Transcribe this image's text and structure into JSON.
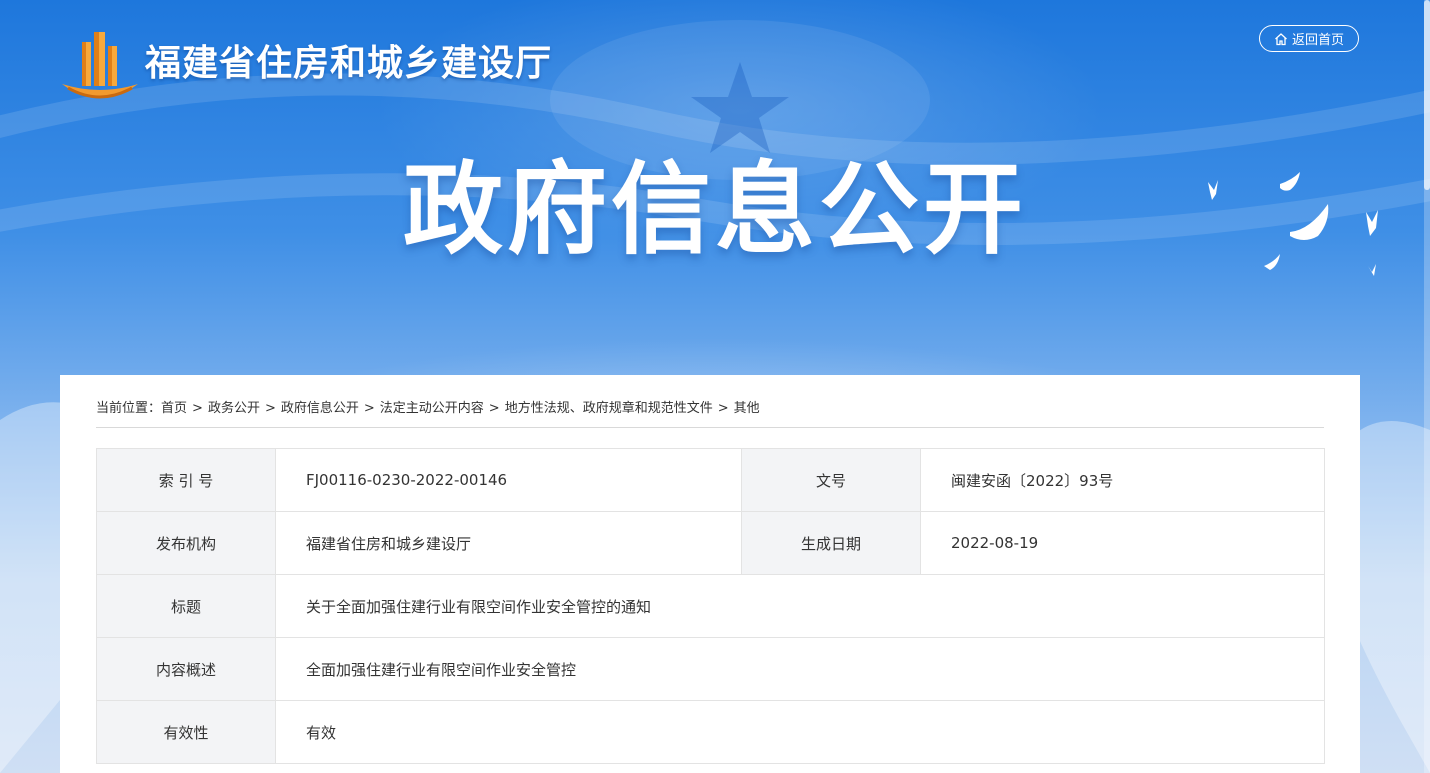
{
  "header": {
    "site_name": "福建省住房和城乡建设厅",
    "home_button_label": "返回首页",
    "hero_title": "政府信息公开"
  },
  "breadcrumb": {
    "prefix": "当前位置：",
    "items": [
      "首页",
      "政务公开",
      "政府信息公开",
      "法定主动公开内容",
      "地方性法规、政府规章和规范性文件",
      "其他"
    ],
    "separator": ">"
  },
  "info": {
    "index_no_label": "索 引 号",
    "index_no_value": "FJ00116-0230-2022-00146",
    "doc_no_label": "文号",
    "doc_no_value": "闽建安函〔2022〕93号",
    "publisher_label": "发布机构",
    "publisher_value": "福建省住房和城乡建设厅",
    "date_label": "生成日期",
    "date_value": "2022-08-19",
    "title_label": "标题",
    "title_value": "关于全面加强住建行业有限空间作业安全管控的通知",
    "summary_label": "内容概述",
    "summary_value": "全面加强住建行业有限空间作业安全管控",
    "validity_label": "有效性",
    "validity_value": "有效"
  },
  "icons": {
    "home": "home-icon",
    "logo": "building-logo-icon",
    "doves": "dove-icon"
  },
  "colors": {
    "banner_top": "#1e77dc",
    "banner_bottom": "#cfdff4",
    "label_bg": "#f3f4f6",
    "logo_orange": "#f29a2e"
  }
}
